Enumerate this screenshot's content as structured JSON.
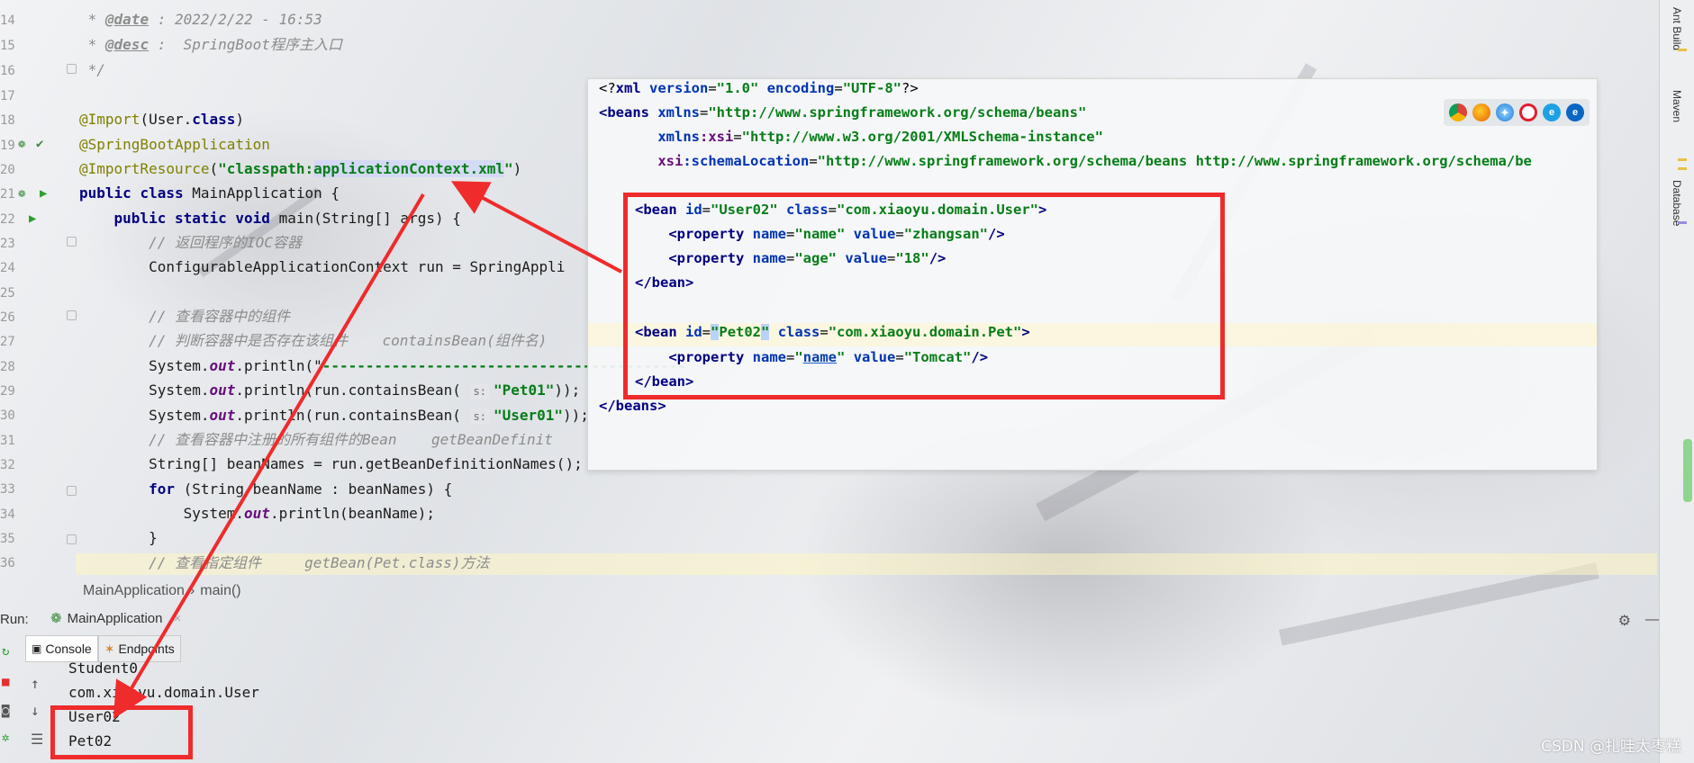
{
  "editor": {
    "line_numbers": [
      "14",
      "15",
      "16",
      "17",
      "18",
      "19",
      "20",
      "21",
      "22",
      "23",
      "24",
      "25",
      "26",
      "27",
      "28",
      "29",
      "30",
      "31",
      "32",
      "33",
      "34",
      "35",
      "36"
    ],
    "javadoc": {
      "date_tag": "@date",
      "date_value": " : 2022/2/22 - 16:53",
      "desc_tag": "@desc",
      "desc_value": " :  SpringBoot程序主入口",
      "close": "*/"
    },
    "import_annotation": "@Import",
    "import_arg": "(User.",
    "import_class_kw": "class",
    "import_close": ")",
    "springboot_annotation": "@SpringBootApplication",
    "import_resource_annotation": "@ImportResource",
    "import_resource_open": "(",
    "import_resource_value": "\"classpath:",
    "import_resource_value_sel": "applicationContext.xml",
    "import_resource_value_end": "\"",
    "import_resource_close": ")",
    "class_decl_kw1": "public",
    "class_decl_kw2": "class",
    "class_decl_rest": " MainApplication {",
    "main_kw1": "public",
    "main_kw2": "static",
    "main_kw3": "void",
    "main_rest": " main(String[] args) {",
    "comment_ioc": "// 返回程序的IOC容器",
    "run_line": "ConfigurableApplicationContext run = SpringAppli",
    "comment_view": "// 查看容器中的组件",
    "comment_contains": "// 判断容器中是否存在该组件    containsBean(组件名)",
    "println_prefix": "System.",
    "out": "out",
    "println_sep_open": ".println(\"",
    "println_sep_dashes": "------------------------------------------",
    "println_contains_open": ".println(run.containsBean(",
    "hint_s": "s:",
    "pet01": "\"Pet01\"",
    "user01": "\"User01\"",
    "println_contains_close": "));",
    "comment_defs": "// 查看容器中注册的所有组件的Bean    getBeanDefinit",
    "bean_names_line": "String[] beanNames = run.getBeanDefinitionNames();",
    "for_kw": "for",
    "for_rest": " (String beanName : beanNames) {",
    "println_bean_open": ".println(beanName);",
    "close_brace": "}",
    "comment_getbean": "// 查看指定组件     getBean(Pet.class)方法"
  },
  "breadcrumb": [
    "MainApplication",
    "›",
    "main()"
  ],
  "xml_popup": {
    "decl_open": "<?",
    "decl_name": "xml",
    "decl_version_attr": " version",
    "decl_version_val": "\"1.0\"",
    "decl_encoding_attr": " encoding",
    "decl_encoding_val": "\"UTF-8\"",
    "decl_close": "?>",
    "beans_open": "<beans",
    "xmlns_attr": " xmlns",
    "xmlns_val": "\"http://www.springframework.org/schema/beans\"",
    "xmlns_xsi_ns": "xmlns",
    "xmlns_xsi_name": ":xsi",
    "xmlns_xsi_val": "\"http://www.w3.org/2001/XMLSchema-instance\"",
    "schema_ns": "xsi",
    "schema_name": ":schemaLocation",
    "schema_val": "\"http://www.springframework.org/schema/beans http://www.springframework.org/schema/be",
    "bean_tag": "<bean",
    "id_attr": " id",
    "user02_val": "\"User02\"",
    "class_attr": " class",
    "user_class_val": "\"com.xiaoyu.domain.User\"",
    "gt": ">",
    "property_tag": "<property",
    "name_attr": " name",
    "value_attr": " value",
    "name_val": "\"name\"",
    "zhangsan_val": "\"zhangsan\"",
    "age_val": "\"age\"",
    "age_value_val": "\"18\"",
    "self_close": "/>",
    "bean_close": "</bean>",
    "pet02_q1": "\"",
    "pet02_sel": "Pet02",
    "pet02_q2": "\"",
    "pet_class_val": "\"com.xiaoyu.domain.Pet\"",
    "prop_name_q1": "\"",
    "prop_name_u": "name",
    "prop_name_q2": "\"",
    "tomcat_val": "\"Tomcat\"",
    "beans_close": "</beans>",
    "browsers": [
      "chrome-icon",
      "firefox-icon",
      "safari-icon",
      "opera-icon",
      "ie-icon",
      "edge-icon"
    ]
  },
  "run_window": {
    "label": "Run:",
    "tab": "MainApplication",
    "tab_close": "×",
    "subtabs": [
      "Console",
      "Endpoints"
    ],
    "console_lines": [
      "Student0",
      "com.xiaoyu.domain.User",
      "User02",
      "Pet02"
    ]
  },
  "right_bar": [
    "Ant Build",
    "Maven",
    "Database"
  ],
  "watermark": "CSDN @扎哇太枣糕",
  "colors": {
    "annotation_red": "#ef2b2b",
    "keyword": "#000080",
    "string": "#067d17"
  }
}
